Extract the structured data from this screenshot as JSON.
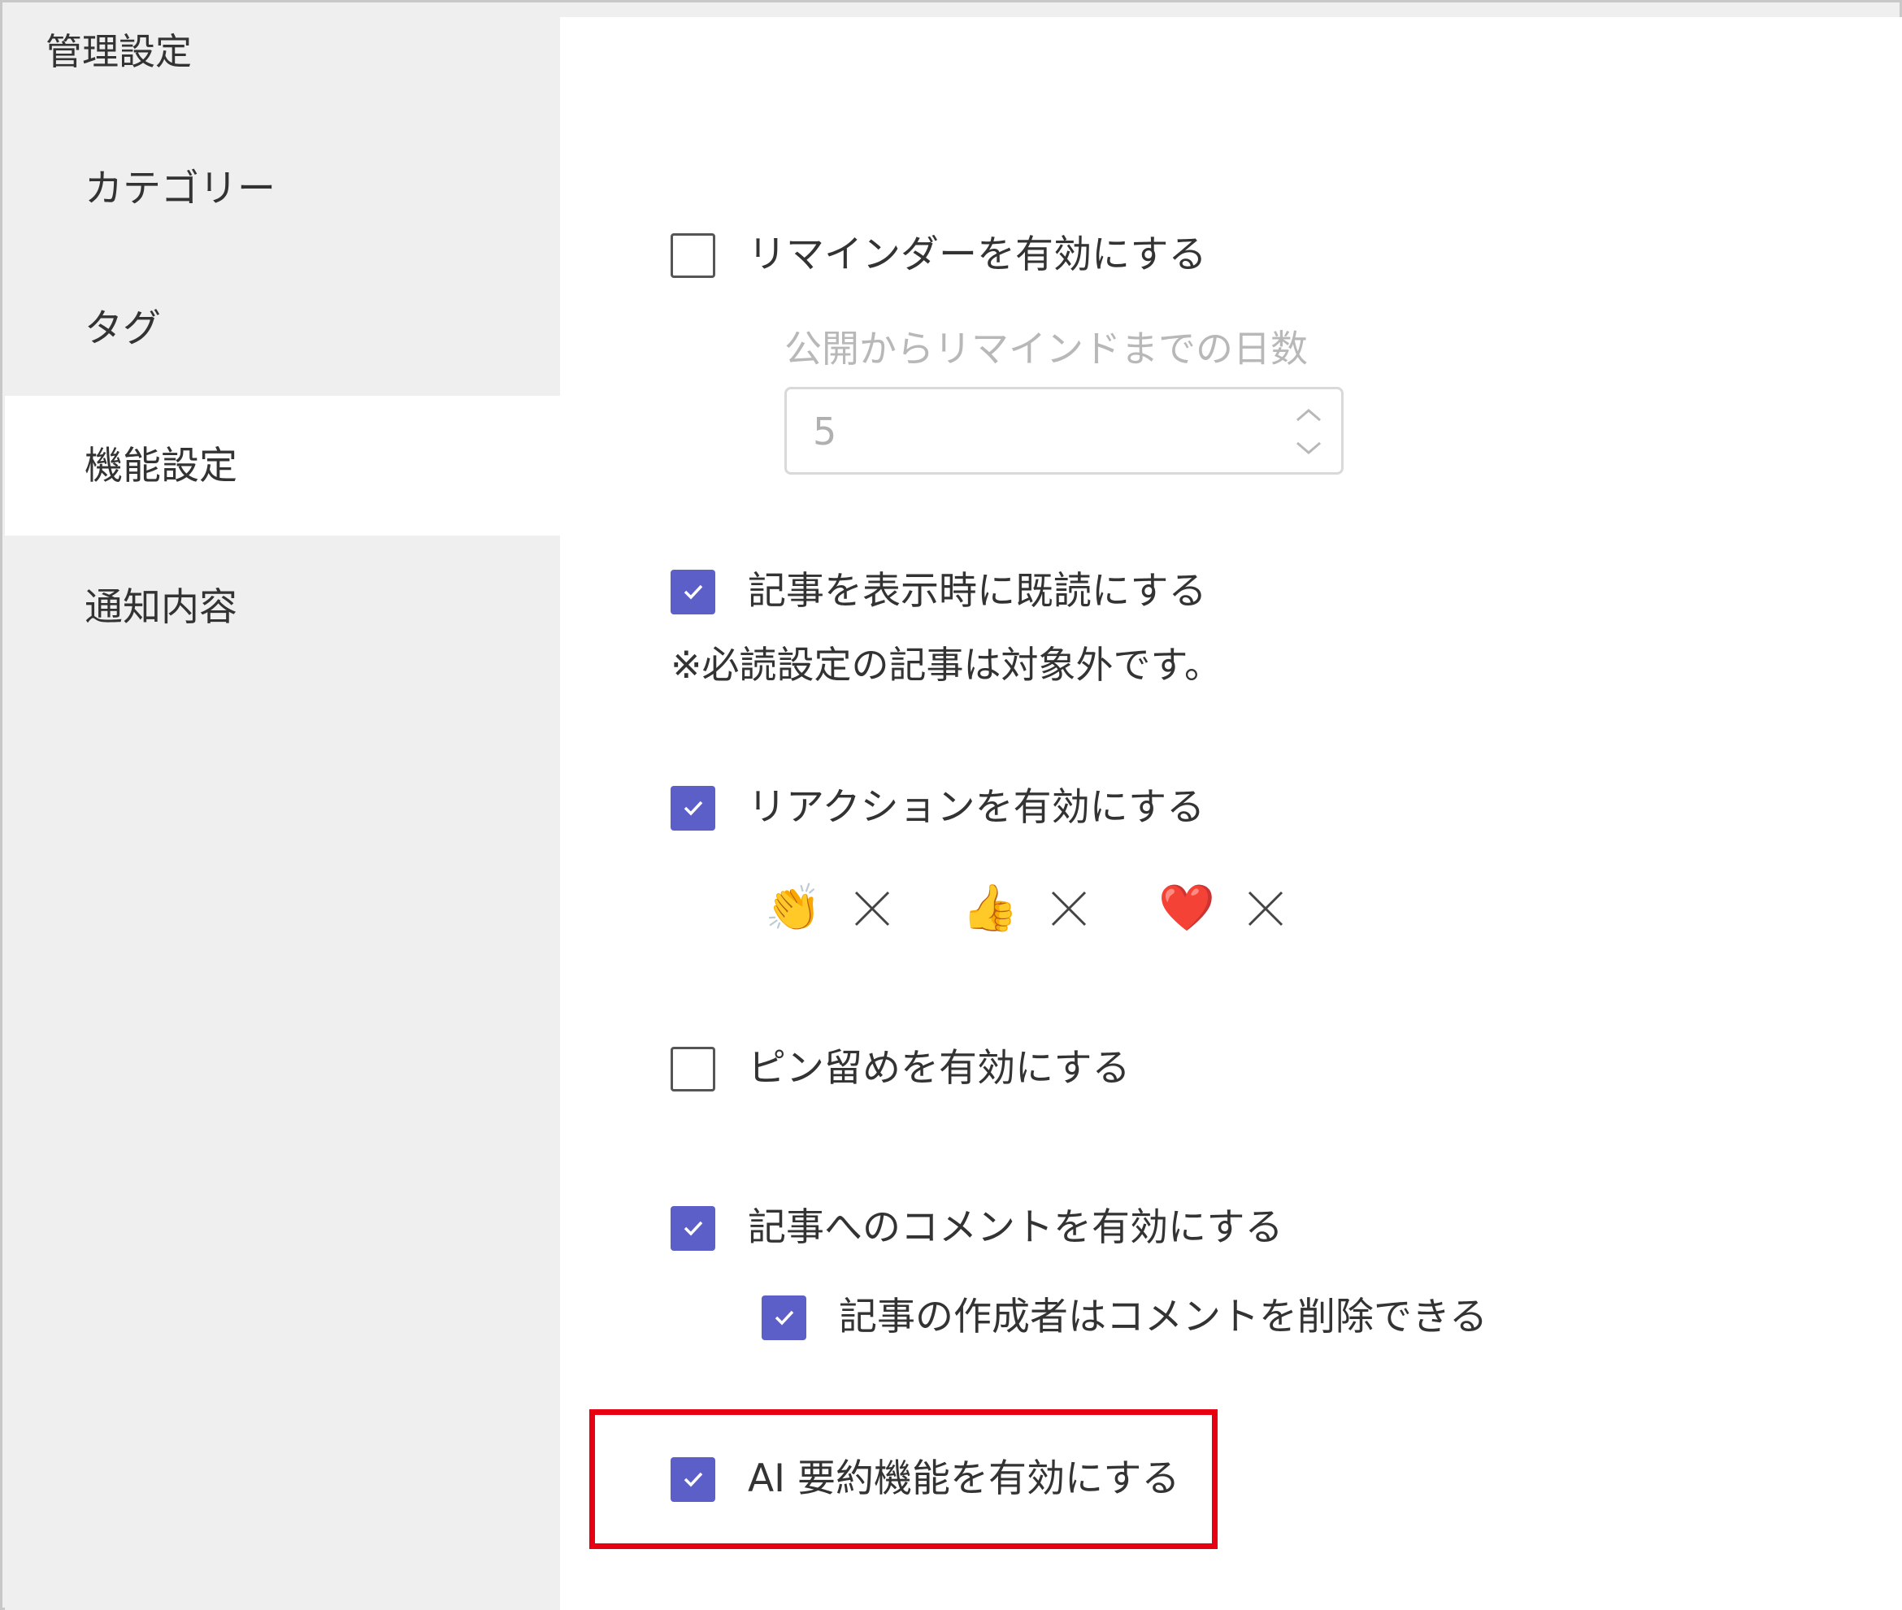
{
  "sidebar": {
    "title": "管理設定",
    "items": [
      {
        "label": "カテゴリー",
        "active": false
      },
      {
        "label": "タグ",
        "active": false
      },
      {
        "label": "機能設定",
        "active": true
      },
      {
        "label": "通知内容",
        "active": false
      }
    ]
  },
  "settings": {
    "reminder": {
      "label": "リマインダーを有効にする",
      "checked": false
    },
    "reminder_days": {
      "label": "公開からリマインドまでの日数",
      "value": "5"
    },
    "mark_read": {
      "label": "記事を表示時に既読にする",
      "checked": true
    },
    "mark_read_note": "※必読設定の記事は対象外です。",
    "reactions": {
      "label": "リアクションを有効にする",
      "checked": true
    },
    "reaction_list": [
      {
        "emoji": "👏",
        "icon": "clapping-hands-icon"
      },
      {
        "emoji": "👍",
        "icon": "thumbs-up-icon"
      },
      {
        "emoji": "❤️",
        "icon": "heart-icon"
      }
    ],
    "pin": {
      "label": "ピン留めを有効にする",
      "checked": false
    },
    "comments": {
      "label": "記事へのコメントを有効にする",
      "checked": true
    },
    "author_delete": {
      "label": "記事の作成者はコメントを削除できる",
      "checked": true
    },
    "ai_summary": {
      "label": "AI 要約機能を有効にする",
      "checked": true
    }
  },
  "colors": {
    "accent": "#5b5fc7",
    "highlight": "#e60012",
    "sidebar_bg": "#efefef"
  }
}
